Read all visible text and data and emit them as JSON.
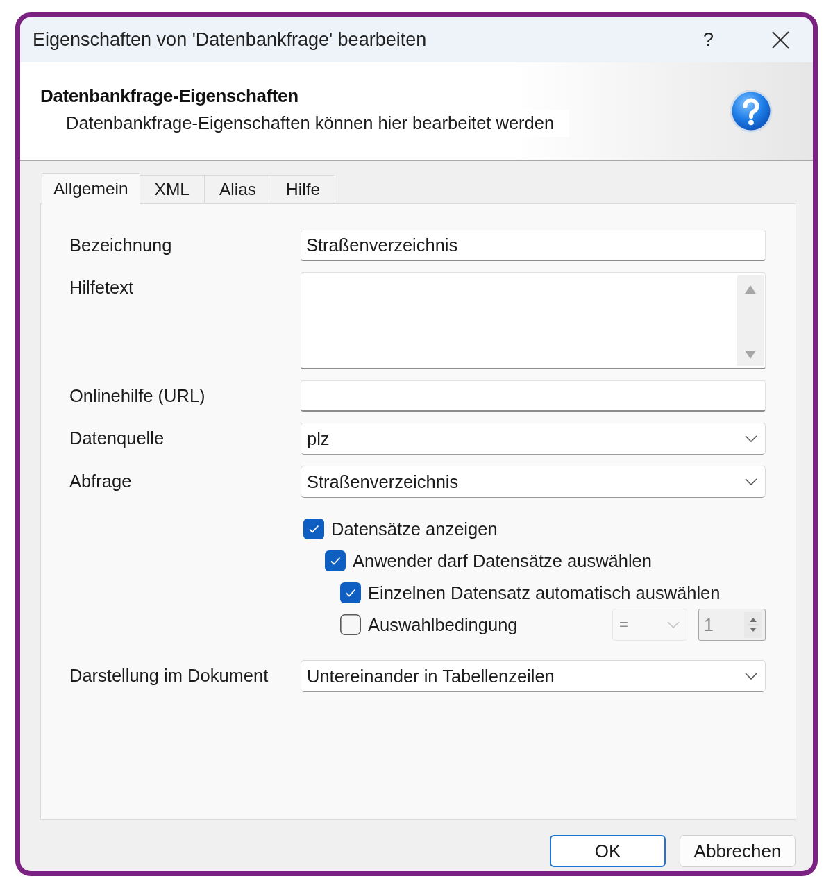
{
  "window": {
    "title": "Eigenschaften von 'Datenbankfrage' bearbeiten",
    "help_glyph": "?"
  },
  "header": {
    "title": "Datenbankfrage-Eigenschaften",
    "subtitle": "Datenbankfrage-Eigenschaften können hier bearbeitet werden"
  },
  "tabs": [
    {
      "label": "Allgemein",
      "selected": true
    },
    {
      "label": "XML",
      "selected": false
    },
    {
      "label": "Alias",
      "selected": false
    },
    {
      "label": "Hilfe",
      "selected": false
    }
  ],
  "fields": [
    {
      "kind": "text",
      "label": "Bezeichnung",
      "value": "Straßenverzeichnis"
    },
    {
      "kind": "textarea",
      "label": "Hilfetext"
    },
    {
      "kind": "text",
      "label": "Onlinehilfe (URL)"
    },
    {
      "kind": "select",
      "label": "Datenquelle",
      "value": "plz"
    },
    {
      "kind": "select",
      "label": "Abfrage",
      "value": "Straßenverzeichnis"
    }
  ],
  "checkboxes": [
    {
      "label": "Datensätze anzeigen",
      "checked": true,
      "children": [
        {
          "label": "Anwender darf Datensätze auswählen",
          "checked": true,
          "children": [
            {
              "label": "Einzelnen Datensatz automatisch auswählen",
              "checked": true
            },
            {
              "label": "Auswahlbedingung",
              "checked": false,
              "operator": {
                "value": "=",
                "disabled": true
              },
              "count": {
                "value": "1",
                "disabled": true
              }
            }
          ]
        }
      ]
    }
  ],
  "display": {
    "kind": "select",
    "label": "Darstellung im Dokument",
    "value": "Untereinander in Tabellenzeilen"
  },
  "buttons": [
    {
      "label": "OK",
      "default": true
    },
    {
      "label": "Abbrechen",
      "default": false
    }
  ]
}
